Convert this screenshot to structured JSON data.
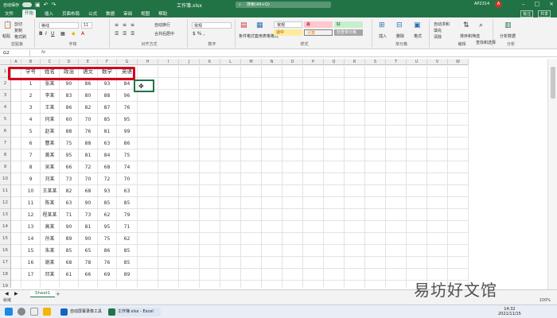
{
  "titlebar": {
    "autosave_label": "自动保存",
    "doc_title": "工作簿.xlsx",
    "search_placeholder": "搜索(Alt+Q)",
    "user": "AP2314",
    "avatar_initial": "A"
  },
  "tabs": [
    "文件",
    "开始",
    "插入",
    "页面布局",
    "公式",
    "数据",
    "审阅",
    "视图",
    "帮助"
  ],
  "active_tab": "开始",
  "share_buttons": [
    "批注",
    "共享"
  ],
  "ribbon": {
    "groups": [
      "剪贴板",
      "字体",
      "对齐方式",
      "数字",
      "样式",
      "单元格",
      "编辑",
      "分析"
    ],
    "clipboard": {
      "paste": "粘贴",
      "cut": "剪切",
      "copy": "复制",
      "format_painter": "格式刷"
    },
    "font": {
      "family": "等线",
      "size": "11"
    },
    "alignment": {
      "wrap": "自动换行",
      "merge": "合并后居中"
    },
    "number": {
      "format": "常规"
    },
    "styles": {
      "conditional": "条件格式",
      "table": "套用表格格式",
      "normal": "常规",
      "bad": "差",
      "good": "好",
      "neutral": "适中",
      "calc": "计算",
      "check": "检查单元格"
    },
    "cells": {
      "insert": "插入",
      "delete": "删除",
      "format": "格式"
    },
    "editing": {
      "autosum": "自动求和",
      "fill": "填充",
      "clear": "清除",
      "sort": "排序和筛选",
      "find": "查找和选择"
    },
    "analysis": {
      "analyze": "分析数据"
    }
  },
  "formula_bar": {
    "name_box": "G2",
    "fx": "fx"
  },
  "columns": [
    "A",
    "B",
    "C",
    "D",
    "E",
    "F",
    "G",
    "H",
    "I",
    "J",
    "K",
    "L",
    "M",
    "N",
    "O",
    "P",
    "Q",
    "R",
    "S",
    "T",
    "U",
    "V",
    "W"
  ],
  "table_headers": [
    "学号",
    "姓名",
    "政治",
    "语文",
    "数学",
    "英语"
  ],
  "rows": [
    [
      "1",
      "张某",
      "90",
      "86",
      "93",
      "84"
    ],
    [
      "2",
      "李某",
      "83",
      "80",
      "88",
      "96"
    ],
    [
      "3",
      "王某",
      "86",
      "82",
      "87",
      "76"
    ],
    [
      "4",
      "何某",
      "60",
      "70",
      "85",
      "95"
    ],
    [
      "5",
      "赵某",
      "88",
      "76",
      "81",
      "99"
    ],
    [
      "6",
      "曹某",
      "75",
      "88",
      "63",
      "86"
    ],
    [
      "7",
      "黄某",
      "95",
      "81",
      "84",
      "75"
    ],
    [
      "8",
      "吴某",
      "66",
      "72",
      "68",
      "74"
    ],
    [
      "9",
      "刘某",
      "73",
      "70",
      "72",
      "70"
    ],
    [
      "10",
      "王某某",
      "82",
      "68",
      "93",
      "63"
    ],
    [
      "11",
      "陈某",
      "63",
      "90",
      "85",
      "85"
    ],
    [
      "12",
      "程某某",
      "71",
      "73",
      "62",
      "79"
    ],
    [
      "13",
      "高某",
      "90",
      "81",
      "95",
      "71"
    ],
    [
      "14",
      "孙某",
      "89",
      "90",
      "75",
      "62"
    ],
    [
      "15",
      "朱某",
      "85",
      "65",
      "86",
      "85"
    ],
    [
      "16",
      "谢某",
      "68",
      "78",
      "76",
      "85"
    ],
    [
      "17",
      "邓某",
      "61",
      "66",
      "69",
      "89"
    ]
  ],
  "row_numbers": [
    "1",
    "2",
    "3",
    "4",
    "5",
    "6",
    "7",
    "8",
    "9",
    "10",
    "11",
    "12",
    "13",
    "14",
    "15",
    "16",
    "17",
    "18",
    "19"
  ],
  "sheet": {
    "tab": "Sheet1",
    "add": "+"
  },
  "status": {
    "ready": "就绪",
    "zoom": "100%"
  },
  "taskbar": {
    "apps": [
      "自动屏幕录像工具",
      "工作簿.xlsx - Excel"
    ],
    "time": "14:32",
    "date": "2021/11/15"
  },
  "watermark": "易坊好文馆",
  "colors": {
    "excel_green": "#217346",
    "highlight_red": "#d4001b"
  }
}
